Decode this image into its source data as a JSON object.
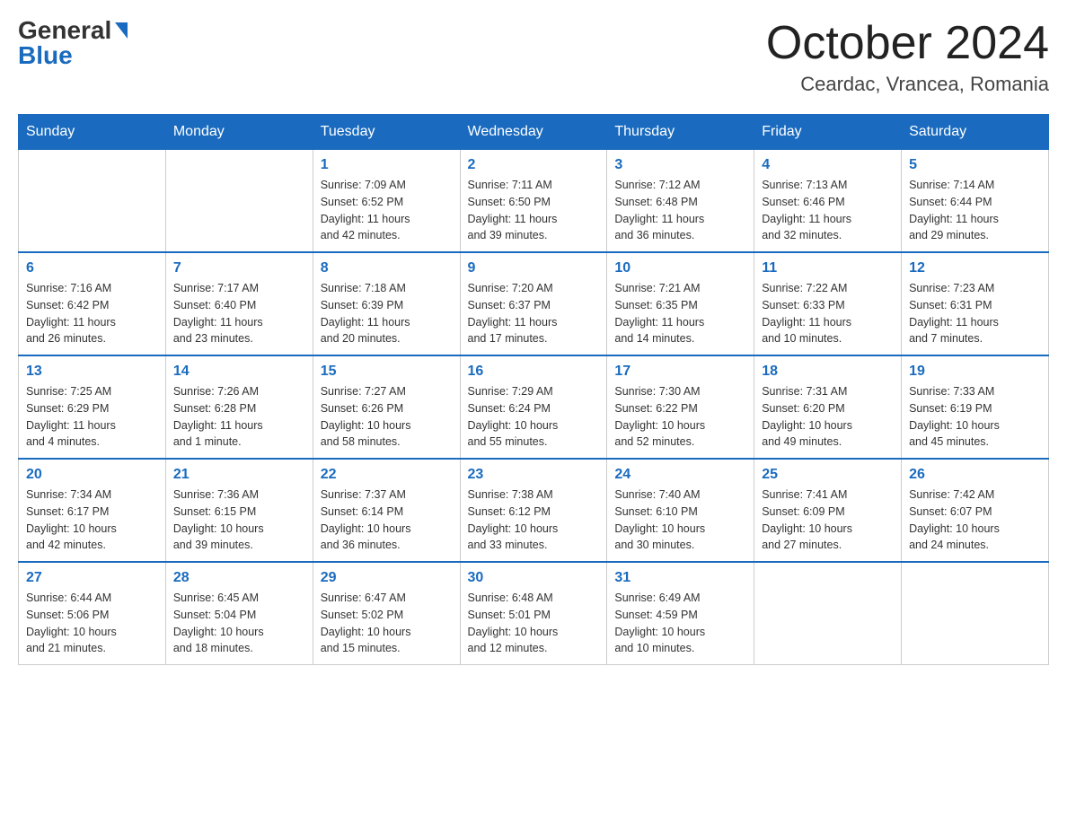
{
  "header": {
    "logo_general": "General",
    "logo_blue": "Blue",
    "month_title": "October 2024",
    "subtitle": "Ceardac, Vrancea, Romania"
  },
  "days_of_week": [
    "Sunday",
    "Monday",
    "Tuesday",
    "Wednesday",
    "Thursday",
    "Friday",
    "Saturday"
  ],
  "weeks": [
    [
      {
        "day": "",
        "info": ""
      },
      {
        "day": "",
        "info": ""
      },
      {
        "day": "1",
        "info": "Sunrise: 7:09 AM\nSunset: 6:52 PM\nDaylight: 11 hours\nand 42 minutes."
      },
      {
        "day": "2",
        "info": "Sunrise: 7:11 AM\nSunset: 6:50 PM\nDaylight: 11 hours\nand 39 minutes."
      },
      {
        "day": "3",
        "info": "Sunrise: 7:12 AM\nSunset: 6:48 PM\nDaylight: 11 hours\nand 36 minutes."
      },
      {
        "day": "4",
        "info": "Sunrise: 7:13 AM\nSunset: 6:46 PM\nDaylight: 11 hours\nand 32 minutes."
      },
      {
        "day": "5",
        "info": "Sunrise: 7:14 AM\nSunset: 6:44 PM\nDaylight: 11 hours\nand 29 minutes."
      }
    ],
    [
      {
        "day": "6",
        "info": "Sunrise: 7:16 AM\nSunset: 6:42 PM\nDaylight: 11 hours\nand 26 minutes."
      },
      {
        "day": "7",
        "info": "Sunrise: 7:17 AM\nSunset: 6:40 PM\nDaylight: 11 hours\nand 23 minutes."
      },
      {
        "day": "8",
        "info": "Sunrise: 7:18 AM\nSunset: 6:39 PM\nDaylight: 11 hours\nand 20 minutes."
      },
      {
        "day": "9",
        "info": "Sunrise: 7:20 AM\nSunset: 6:37 PM\nDaylight: 11 hours\nand 17 minutes."
      },
      {
        "day": "10",
        "info": "Sunrise: 7:21 AM\nSunset: 6:35 PM\nDaylight: 11 hours\nand 14 minutes."
      },
      {
        "day": "11",
        "info": "Sunrise: 7:22 AM\nSunset: 6:33 PM\nDaylight: 11 hours\nand 10 minutes."
      },
      {
        "day": "12",
        "info": "Sunrise: 7:23 AM\nSunset: 6:31 PM\nDaylight: 11 hours\nand 7 minutes."
      }
    ],
    [
      {
        "day": "13",
        "info": "Sunrise: 7:25 AM\nSunset: 6:29 PM\nDaylight: 11 hours\nand 4 minutes."
      },
      {
        "day": "14",
        "info": "Sunrise: 7:26 AM\nSunset: 6:28 PM\nDaylight: 11 hours\nand 1 minute."
      },
      {
        "day": "15",
        "info": "Sunrise: 7:27 AM\nSunset: 6:26 PM\nDaylight: 10 hours\nand 58 minutes."
      },
      {
        "day": "16",
        "info": "Sunrise: 7:29 AM\nSunset: 6:24 PM\nDaylight: 10 hours\nand 55 minutes."
      },
      {
        "day": "17",
        "info": "Sunrise: 7:30 AM\nSunset: 6:22 PM\nDaylight: 10 hours\nand 52 minutes."
      },
      {
        "day": "18",
        "info": "Sunrise: 7:31 AM\nSunset: 6:20 PM\nDaylight: 10 hours\nand 49 minutes."
      },
      {
        "day": "19",
        "info": "Sunrise: 7:33 AM\nSunset: 6:19 PM\nDaylight: 10 hours\nand 45 minutes."
      }
    ],
    [
      {
        "day": "20",
        "info": "Sunrise: 7:34 AM\nSunset: 6:17 PM\nDaylight: 10 hours\nand 42 minutes."
      },
      {
        "day": "21",
        "info": "Sunrise: 7:36 AM\nSunset: 6:15 PM\nDaylight: 10 hours\nand 39 minutes."
      },
      {
        "day": "22",
        "info": "Sunrise: 7:37 AM\nSunset: 6:14 PM\nDaylight: 10 hours\nand 36 minutes."
      },
      {
        "day": "23",
        "info": "Sunrise: 7:38 AM\nSunset: 6:12 PM\nDaylight: 10 hours\nand 33 minutes."
      },
      {
        "day": "24",
        "info": "Sunrise: 7:40 AM\nSunset: 6:10 PM\nDaylight: 10 hours\nand 30 minutes."
      },
      {
        "day": "25",
        "info": "Sunrise: 7:41 AM\nSunset: 6:09 PM\nDaylight: 10 hours\nand 27 minutes."
      },
      {
        "day": "26",
        "info": "Sunrise: 7:42 AM\nSunset: 6:07 PM\nDaylight: 10 hours\nand 24 minutes."
      }
    ],
    [
      {
        "day": "27",
        "info": "Sunrise: 6:44 AM\nSunset: 5:06 PM\nDaylight: 10 hours\nand 21 minutes."
      },
      {
        "day": "28",
        "info": "Sunrise: 6:45 AM\nSunset: 5:04 PM\nDaylight: 10 hours\nand 18 minutes."
      },
      {
        "day": "29",
        "info": "Sunrise: 6:47 AM\nSunset: 5:02 PM\nDaylight: 10 hours\nand 15 minutes."
      },
      {
        "day": "30",
        "info": "Sunrise: 6:48 AM\nSunset: 5:01 PM\nDaylight: 10 hours\nand 12 minutes."
      },
      {
        "day": "31",
        "info": "Sunrise: 6:49 AM\nSunset: 4:59 PM\nDaylight: 10 hours\nand 10 minutes."
      },
      {
        "day": "",
        "info": ""
      },
      {
        "day": "",
        "info": ""
      }
    ]
  ]
}
